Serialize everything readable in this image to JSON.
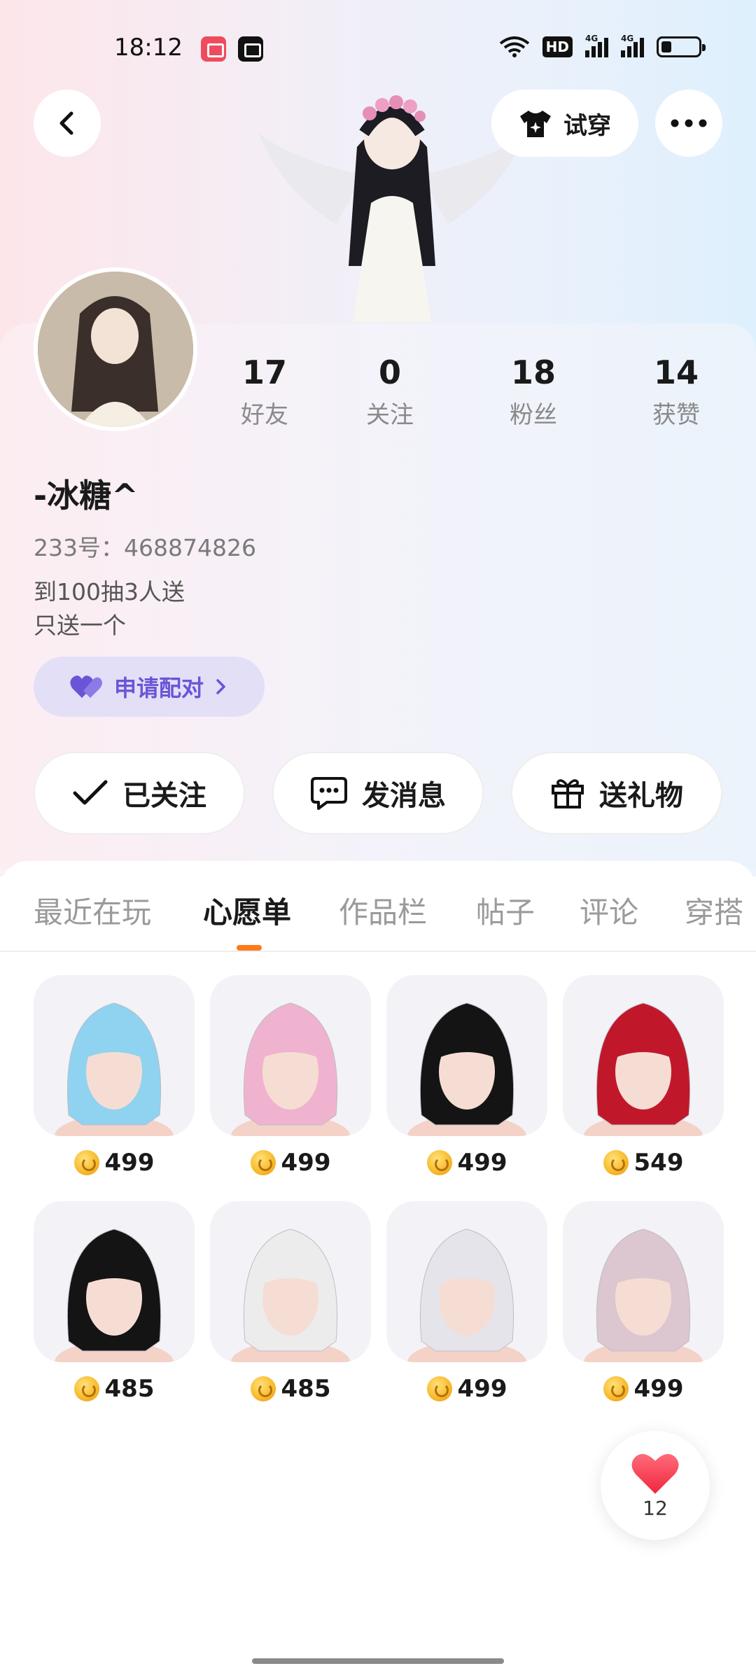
{
  "status_bar": {
    "time": "18:12",
    "hd_label": "HD",
    "signal_label_1": "4G",
    "signal_label_2": "4G"
  },
  "header": {
    "try_on_label": "试穿"
  },
  "profile": {
    "stats": [
      {
        "value": "17",
        "label": "好友"
      },
      {
        "value": "0",
        "label": "关注"
      },
      {
        "value": "18",
        "label": "粉丝"
      },
      {
        "value": "14",
        "label": "获赞"
      }
    ],
    "username": "-冰糖^",
    "uid": "233号：468874826",
    "bio_line1": "到100抽3人送",
    "bio_line2": "只送一个",
    "pair_label": "申请配对"
  },
  "actions": {
    "follow_label": "已关注",
    "message_label": "发消息",
    "gift_label": "送礼物"
  },
  "tabs": [
    {
      "label": "最近在玩"
    },
    {
      "label": "心愿单"
    },
    {
      "label": "作品栏"
    },
    {
      "label": "帖子"
    },
    {
      "label": "评论"
    },
    {
      "label": "穿搭"
    }
  ],
  "active_tab": "心愿单",
  "wishlist": [
    {
      "price": "499",
      "hair_color": "#8fd3f0"
    },
    {
      "price": "499",
      "hair_color": "#efb3cf"
    },
    {
      "price": "499",
      "hair_color": "#141414"
    },
    {
      "price": "549",
      "hair_color": "#c0182a"
    },
    {
      "price": "485",
      "hair_color": "#141414"
    },
    {
      "price": "485",
      "hair_color": "#ececec"
    },
    {
      "price": "499",
      "hair_color": "#e4e4ea"
    },
    {
      "price": "499",
      "hair_color": "#dcc6cf"
    }
  ],
  "like_float": {
    "count": "12"
  },
  "colors": {
    "accent_orange": "#ff7a1a",
    "pair_purple": "#6a55d6",
    "like_red": "#ff3b4e"
  }
}
